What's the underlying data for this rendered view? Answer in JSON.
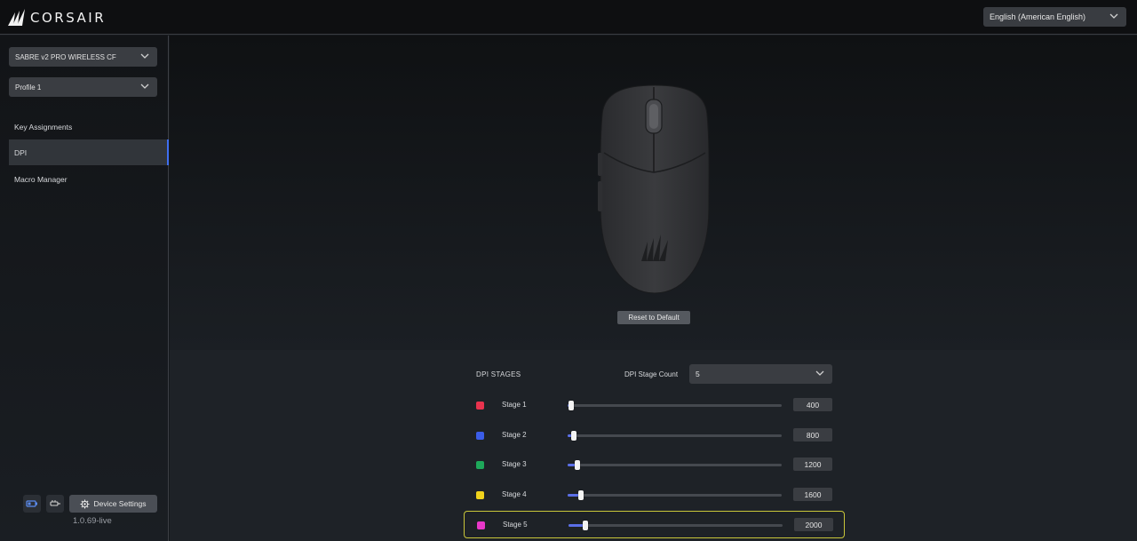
{
  "app": {
    "brand": "CORSAIR"
  },
  "header": {
    "language": "English (American English)"
  },
  "sidebar": {
    "device": "SABRE v2 PRO WIRELESS CF",
    "profile": "Profile 1",
    "items": [
      {
        "label": "Key Assignments"
      },
      {
        "label": "DPI"
      },
      {
        "label": "Macro Manager"
      }
    ],
    "active_item": "DPI",
    "device_settings_label": "Device Settings",
    "version": "1.0.69-live"
  },
  "main": {
    "reset_label": "Reset to Default",
    "dpi": {
      "title": "DPI STAGES",
      "stage_count_label": "DPI Stage Count",
      "stage_count": "5",
      "slider_max": 26000,
      "stages": [
        {
          "label": "Stage 1",
          "value": "400",
          "color": "#e8334e",
          "level": 400
        },
        {
          "label": "Stage 2",
          "value": "800",
          "color": "#3b5de8",
          "level": 800
        },
        {
          "label": "Stage 3",
          "value": "1200",
          "color": "#1ea85a",
          "level": 1200
        },
        {
          "label": "Stage 4",
          "value": "1600",
          "color": "#f0d21c",
          "level": 1600
        },
        {
          "label": "Stage 5",
          "value": "2000",
          "color": "#e838c9",
          "level": 2000
        }
      ],
      "selected_stage": "Stage 5"
    }
  },
  "colors": {
    "accent": "#3f6ff0",
    "selected_outline": "#c9c63a"
  }
}
